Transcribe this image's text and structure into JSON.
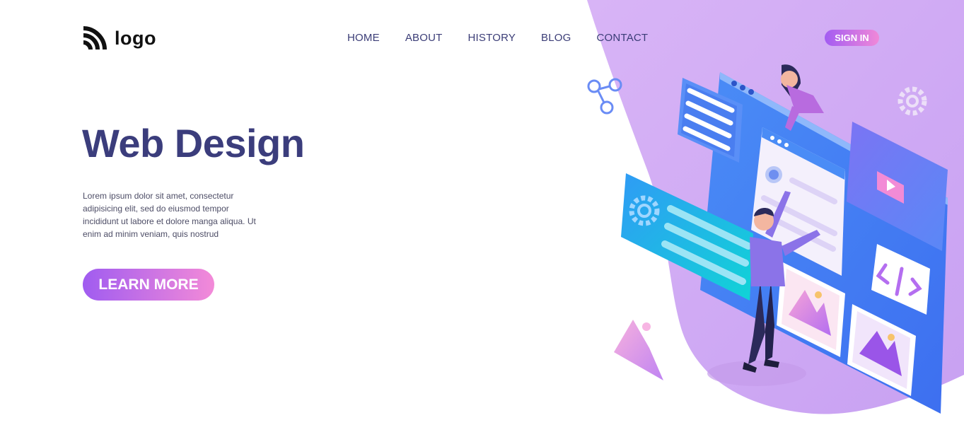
{
  "brand": {
    "logo_text": "logo",
    "logo_icon": "wifi-rss-icon"
  },
  "nav": {
    "items": [
      {
        "label": "HOME"
      },
      {
        "label": "ABOUT"
      },
      {
        "label": "HISTORY"
      },
      {
        "label": "BLOG"
      },
      {
        "label": "CONTACT"
      }
    ],
    "signin_label": "SIGN IN"
  },
  "hero": {
    "title": "Web Design",
    "body": "Lorem ipsum dolor sit amet, consectetur adipisicing elit, sed do eiusmod tempor incididunt ut labore et dolore manga aliqua. Ut enim ad minim veniam, quis nostrud",
    "cta_label": "LEARN MORE"
  },
  "illustration": {
    "icons": [
      "share-icon",
      "gear-icon",
      "code-icon",
      "image-icon",
      "play-icon",
      "mountain-icon"
    ]
  },
  "colors": {
    "accent_start": "#a05cf0",
    "accent_end": "#f38ad8",
    "title": "#3b3d7c",
    "nav_text": "#3b3d77",
    "blob": "#d7b1f5",
    "screen_blue": "#4f8ff5"
  }
}
